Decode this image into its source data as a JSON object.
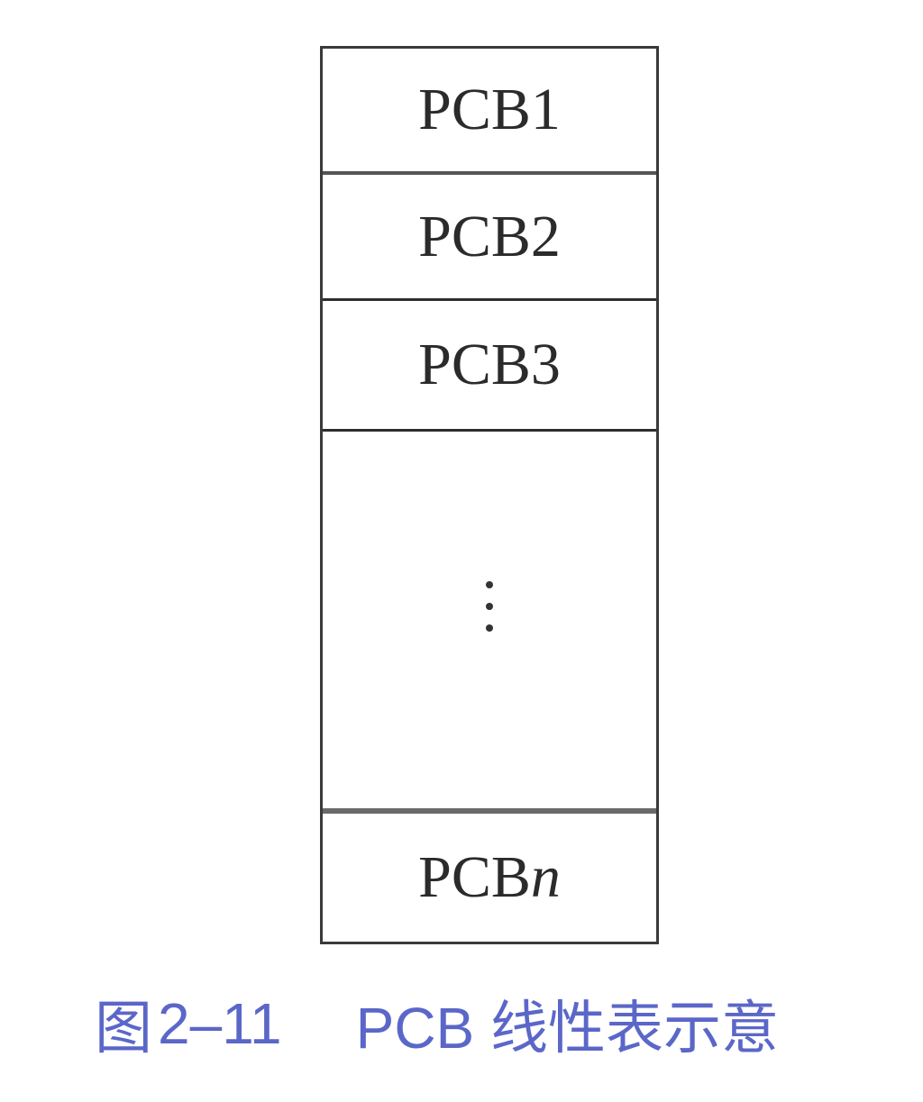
{
  "diagram": {
    "cells": [
      {
        "label": "PCB1"
      },
      {
        "label": "PCB2"
      },
      {
        "label": "PCB3"
      }
    ],
    "ellipsis": "⋮",
    "last_cell": {
      "prefix": "PCB",
      "suffix_italic": "n"
    }
  },
  "caption": {
    "figure_label": "图",
    "figure_number": "2–11",
    "text": "PCB 线性表示意"
  },
  "colors": {
    "caption": "#5b67c8",
    "border": "#3a3a3a",
    "text": "#2b2b2b"
  }
}
